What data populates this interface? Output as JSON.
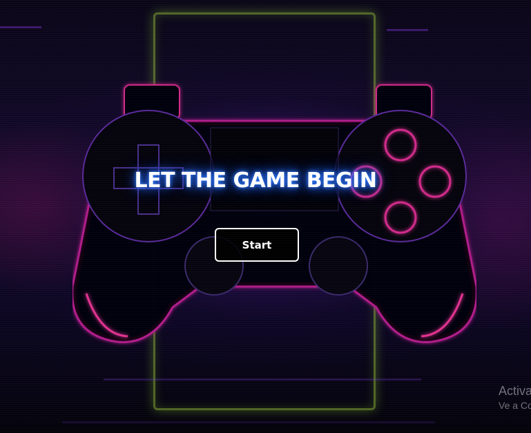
{
  "hero": {
    "title": "LET THE GAME BEGIN",
    "start_label": "Start"
  },
  "watermark": {
    "line1": "Activa",
    "line2": "Ve a Co"
  },
  "icons": [
    "game-controller-icon"
  ],
  "colors": {
    "background": "#05030d",
    "glow_purple": "#5a1ea0",
    "glow_magenta": "#c0208a",
    "title_glow": "#2f7bff",
    "neon_frame": "#aadc3c",
    "button_border": "#ffffff"
  }
}
